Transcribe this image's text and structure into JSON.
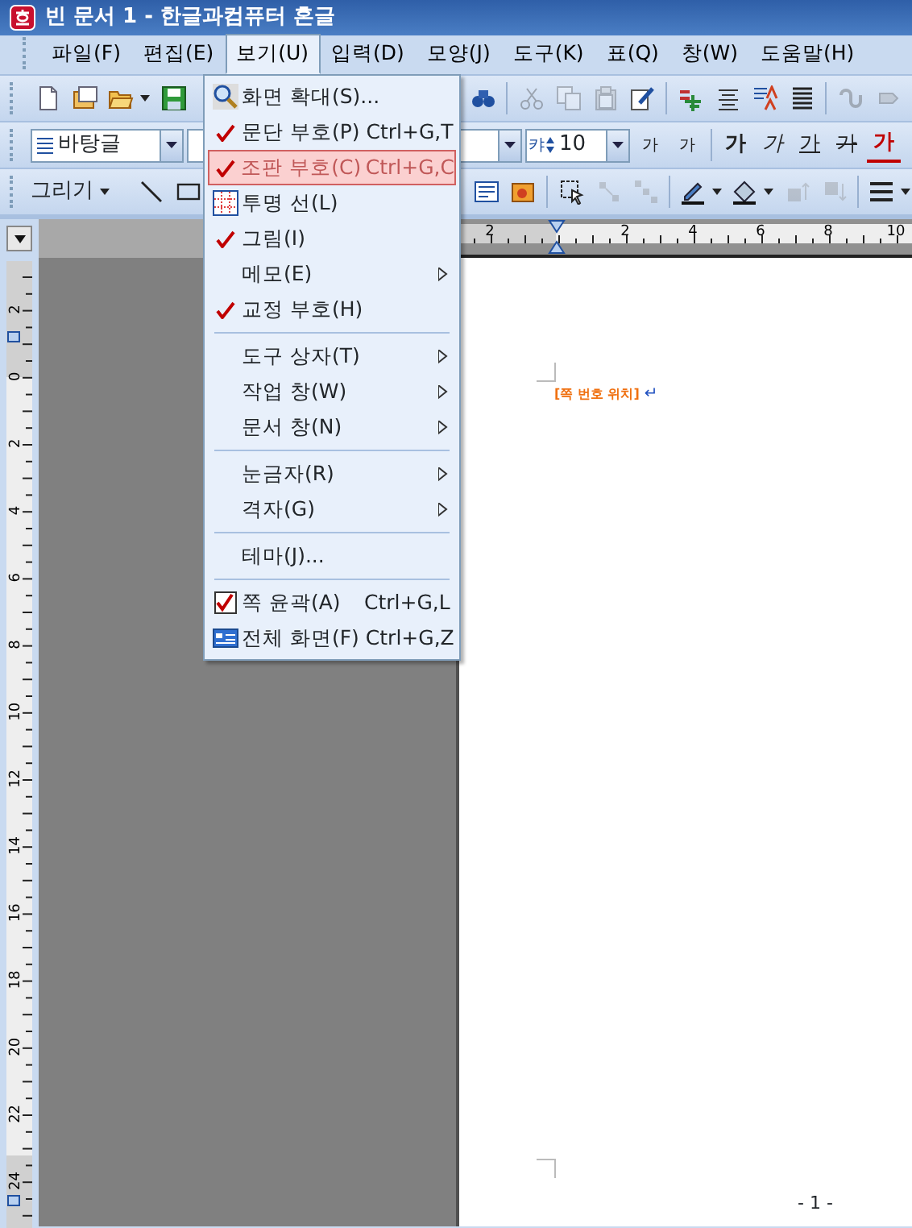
{
  "window": {
    "title": "빈 문서 1 - 한글과컴퓨터 혼글"
  },
  "menu_bar": [
    {
      "text": "파일(F)",
      "selected": false
    },
    {
      "text": "편집(E)",
      "selected": false
    },
    {
      "text": "보기(U)",
      "selected": true
    },
    {
      "text": "입력(D)",
      "selected": false
    },
    {
      "text": "모양(J)",
      "selected": false
    },
    {
      "text": "도구(K)",
      "selected": false
    },
    {
      "text": "표(Q)",
      "selected": false
    },
    {
      "text": "창(W)",
      "selected": false
    },
    {
      "text": "도움말(H)",
      "selected": false
    }
  ],
  "standard_toolbar": [
    {
      "kind": "button",
      "disabled": false
    },
    {
      "kind": "button",
      "disabled": false
    },
    {
      "kind": "dropdown",
      "disabled": false
    },
    {
      "kind": "button",
      "disabled": false
    },
    {
      "kind": "hidden"
    },
    {
      "kind": "button",
      "disabled": false
    },
    {
      "kind": "separator"
    },
    {
      "kind": "button",
      "disabled": true
    },
    {
      "kind": "button",
      "disabled": true
    },
    {
      "kind": "button",
      "disabled": true
    },
    {
      "kind": "button",
      "disabled": false
    },
    {
      "kind": "separator"
    },
    {
      "kind": "button",
      "disabled": false
    },
    {
      "kind": "button",
      "disabled": false
    },
    {
      "kind": "button",
      "disabled": false
    },
    {
      "kind": "button",
      "disabled": false
    },
    {
      "kind": "separator"
    },
    {
      "kind": "button",
      "disabled": true
    },
    {
      "kind": "button",
      "disabled": true
    }
  ],
  "format_toolbar": {
    "style": "바탕글",
    "size_label": "캬",
    "size": "10",
    "buttons": [
      {
        "kind": "shrink",
        "text": "가"
      },
      {
        "kind": "grow",
        "text": "가"
      },
      {
        "kind": "separator"
      },
      {
        "kind": "bold",
        "text": "가"
      },
      {
        "kind": "italic",
        "text": "가"
      },
      {
        "kind": "underline",
        "text": "가"
      },
      {
        "kind": "strike",
        "text": "가"
      },
      {
        "kind": "color",
        "text": "가"
      }
    ]
  },
  "drawing_toolbar": {
    "label": "그리기",
    "buttons": [
      {
        "kind": "button",
        "disabled": false
      },
      {
        "kind": "button",
        "disabled": false
      },
      {
        "kind": "hidden"
      },
      {
        "kind": "button",
        "disabled": false
      },
      {
        "kind": "button",
        "disabled": false
      },
      {
        "kind": "separator"
      },
      {
        "kind": "button",
        "disabled": false
      },
      {
        "kind": "button",
        "disabled": true
      },
      {
        "kind": "button",
        "disabled": true
      },
      {
        "kind": "separator"
      },
      {
        "kind": "dropdown",
        "disabled": false
      },
      {
        "kind": "dropdown",
        "disabled": false
      },
      {
        "kind": "button",
        "disabled": true
      },
      {
        "kind": "button",
        "disabled": true
      },
      {
        "kind": "separator"
      },
      {
        "kind": "dropdown",
        "disabled": false
      }
    ]
  },
  "view_menu": [
    {
      "kind": "command",
      "text": "화면 확대(S)...",
      "icon": true,
      "selected": false
    },
    {
      "kind": "toggle",
      "text": "문단 부호(P)",
      "shortcut": "Ctrl+G,T",
      "checked": true,
      "selected": false
    },
    {
      "kind": "toggle",
      "text": "조판 부호(C)",
      "shortcut": "Ctrl+G,C",
      "checked": true,
      "selected": true
    },
    {
      "kind": "command",
      "text": "투명 선(L)",
      "icon": true,
      "selected": false
    },
    {
      "kind": "toggle",
      "text": "그림(I)",
      "checked": true,
      "selected": false
    },
    {
      "kind": "submenu",
      "text": "메모(E)",
      "selected": false
    },
    {
      "kind": "toggle",
      "text": "교정 부호(H)",
      "checked": true,
      "selected": false
    },
    {
      "kind": "separator"
    },
    {
      "kind": "submenu",
      "text": "도구 상자(T)",
      "selected": false
    },
    {
      "kind": "submenu",
      "text": "작업 창(W)",
      "selected": false
    },
    {
      "kind": "submenu",
      "text": "문서 창(N)",
      "selected": false
    },
    {
      "kind": "separator"
    },
    {
      "kind": "submenu",
      "text": "눈금자(R)",
      "selected": false
    },
    {
      "kind": "submenu",
      "text": "격자(G)",
      "selected": false
    },
    {
      "kind": "separator"
    },
    {
      "kind": "command",
      "text": "테마(J)...",
      "icon": false,
      "selected": false
    },
    {
      "kind": "separator"
    },
    {
      "kind": "checkbox",
      "text": "쪽 윤곽(A)",
      "shortcut": "Ctrl+G,L",
      "checked": true,
      "selected": false
    },
    {
      "kind": "command",
      "text": "전체 화면(F)",
      "shortcut": "Ctrl+G,Z",
      "icon": true,
      "selected": false
    }
  ],
  "horizontal_ruler": [
    "2",
    "2",
    "4",
    "6",
    "8",
    "10"
  ],
  "vertical_ruler": [
    "2",
    "0",
    "2",
    "4",
    "6",
    "8",
    "10",
    "12",
    "14",
    "16",
    "18",
    "20",
    "22",
    "24"
  ],
  "page": {
    "marker": "[쪽 번호 위치]",
    "paragraph_mark": "↵",
    "page_number": "- 1 -"
  }
}
